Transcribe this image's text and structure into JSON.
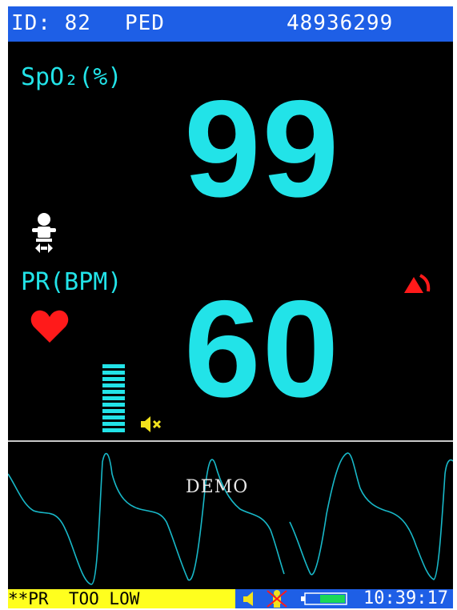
{
  "header": {
    "patient_id": "ID: 82",
    "patient_type": "PED",
    "serial_number": "48936299"
  },
  "spo2": {
    "label": "SpO₂(%)",
    "value": "99"
  },
  "pulse_rate": {
    "label": "PR(BPM)",
    "value": "60"
  },
  "waveform": {
    "watermark": "DEMO"
  },
  "status_bar": {
    "alarm_message": "**PR  TOO LOW",
    "time": "10:39:17"
  },
  "icons": {
    "patient_mode": "infant-icon",
    "pulse": "heart-icon",
    "alarm": "alarm-bell-icon",
    "sound": "mute-icon",
    "status_sound": "speaker-icon",
    "sensor": "sensor-off-icon",
    "battery": "battery-icon"
  },
  "colors": {
    "screen_bg": "#000000",
    "header_bg": "#1e5fe6",
    "value_color": "#22e3e8",
    "alarm_red": "#ff1a1a",
    "alarm_msg_bg": "#ffff1e",
    "mute_yellow": "#f2e21c"
  }
}
